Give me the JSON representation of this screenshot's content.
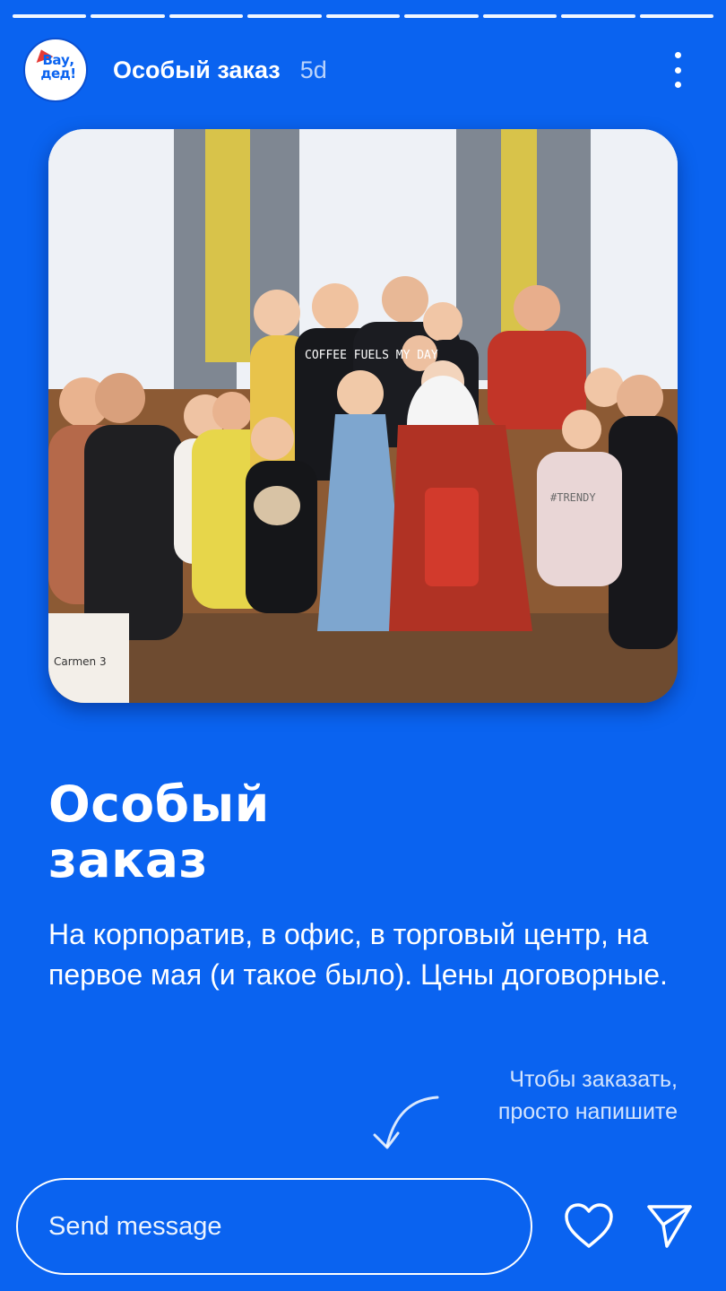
{
  "story": {
    "progress_segments": 9,
    "background_color": "#0a63f0"
  },
  "header": {
    "avatar_logo": "Вау, дед!",
    "title": "Особый заказ",
    "time": "5d",
    "more_icon": "more-vertical-icon"
  },
  "photo": {
    "shirt_text": "COFFEE FUELS MY DAY",
    "shirt_text_2": "#TRENDY",
    "box_text": "Carmen 3"
  },
  "content": {
    "heading_line1": "Особый",
    "heading_line2": "заказ",
    "body": "На корпоратив, в офис, в торговый центр, на первое мая (и такое было). Цены договорные.",
    "hint_line1": "Чтобы заказать,",
    "hint_line2": "просто напишите"
  },
  "footer": {
    "message_placeholder": "Send message",
    "like_icon": "heart-icon",
    "send_icon": "send-icon"
  }
}
